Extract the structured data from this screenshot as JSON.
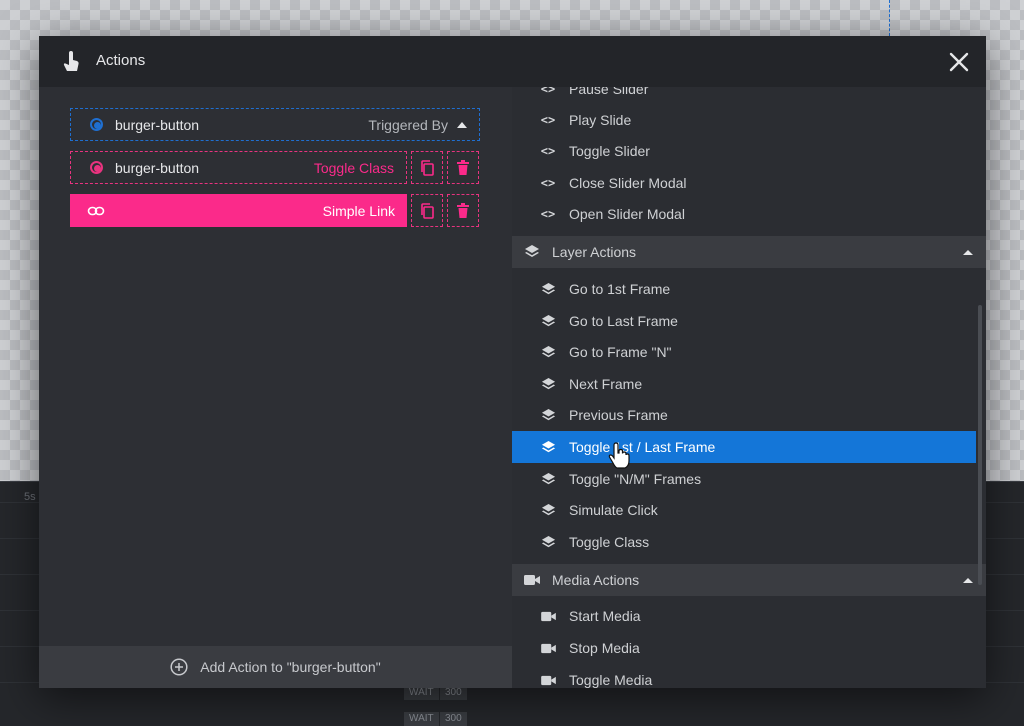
{
  "header": {
    "title": "Actions",
    "close_label": "×"
  },
  "actions": {
    "trigger": {
      "name": "burger-button",
      "label": "Triggered By"
    },
    "toggle": {
      "name": "burger-button",
      "label": "Toggle Class"
    },
    "link": {
      "label": "Simple Link"
    }
  },
  "add_action_label": "Add Action to \"burger-button\"",
  "slider_items": [
    "Pause Slider",
    "Play Slide",
    "Toggle Slider",
    "Close Slider Modal",
    "Open Slider Modal"
  ],
  "layer_actions": {
    "title": "Layer Actions",
    "items": [
      "Go to 1st Frame",
      "Go to Last Frame",
      "Go to Frame \"N\"",
      "Next Frame",
      "Previous Frame",
      "Toggle 1st / Last Frame",
      "Toggle \"N/M\" Frames",
      "Simulate Click",
      "Toggle Class"
    ],
    "selected": "Toggle 1st / Last Frame"
  },
  "media_actions": {
    "title": "Media Actions",
    "items": [
      "Start Media",
      "Stop Media",
      "Toggle Media"
    ]
  },
  "background": {
    "time_label": "5s",
    "chips": [
      "WAIT",
      "300",
      "WAIT",
      "300"
    ]
  },
  "colors": {
    "accent_blue": "#1476d8",
    "accent_pink": "#fb2a8a",
    "modal_bg": "#2d2f34",
    "header_bg": "#232529"
  }
}
